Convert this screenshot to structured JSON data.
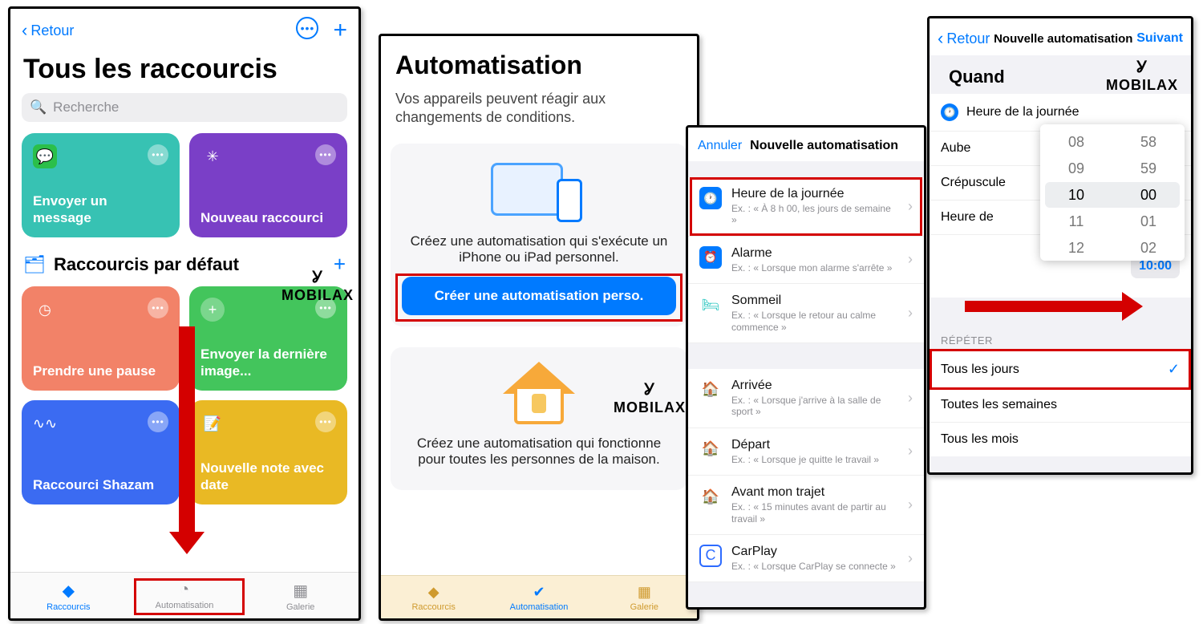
{
  "screen1": {
    "back": "Retour",
    "title": "Tous les raccourcis",
    "search_placeholder": "Recherche",
    "tiles": [
      {
        "label": "Envoyer un message",
        "color": "teal"
      },
      {
        "label": "Nouveau raccourci",
        "color": "purple"
      },
      {
        "label": "Prendre une pause",
        "color": "coral"
      },
      {
        "label": "Envoyer la dernière image...",
        "color": "green"
      },
      {
        "label": "Raccourci Shazam",
        "color": "blue"
      },
      {
        "label": "Nouvelle note avec date",
        "color": "yellow"
      }
    ],
    "folder": "Raccourcis par défaut",
    "tabs": [
      "Raccourcis",
      "Automatisation",
      "Galerie"
    ]
  },
  "screen2": {
    "title": "Automatisation",
    "subtitle": "Vos appareils peuvent réagir aux changements de conditions.",
    "card1_desc": "Créez une automatisation qui s'exécute un iPhone ou iPad personnel.",
    "card1_button": "Créer une automatisation perso.",
    "card2_desc": "Créez une automatisation qui fonctionne pour toutes les personnes de la maison.",
    "tabs": [
      "Raccourcis",
      "Automatisation",
      "Galerie"
    ]
  },
  "screen3": {
    "cancel": "Annuler",
    "title": "Nouvelle automatisation",
    "rows": [
      {
        "name": "Heure de la journée",
        "ex": "Ex. : « À 8 h 00, les jours de semaine »",
        "icon": "clock"
      },
      {
        "name": "Alarme",
        "ex": "Ex. : « Lorsque mon alarme s'arrête »",
        "icon": "alarm"
      },
      {
        "name": "Sommeil",
        "ex": "Ex. : « Lorsque le retour au calme commence »",
        "icon": "bed"
      },
      {
        "name": "Arrivée",
        "ex": "Ex. : « Lorsque j'arrive à la salle de sport »",
        "icon": "home"
      },
      {
        "name": "Départ",
        "ex": "Ex. : « Lorsque je quitte le travail »",
        "icon": "home"
      },
      {
        "name": "Avant mon trajet",
        "ex": "Ex. : « 15 minutes avant de partir au travail »",
        "icon": "home"
      },
      {
        "name": "CarPlay",
        "ex": "Ex. : « Lorsque CarPlay se connecte »",
        "icon": "cp"
      }
    ]
  },
  "screen4": {
    "back": "Retour",
    "title": "Nouvelle automatisation",
    "next": "Suivant",
    "quand": "Quand",
    "row_title": "Heure de la journée",
    "options": [
      "Aube",
      "Crépuscule",
      "Heure de"
    ],
    "time": "10:00",
    "repeat_label": "RÉPÉTER",
    "repeat_opts": [
      "Tous les jours",
      "Toutes les semaines",
      "Tous les mois"
    ],
    "picker": {
      "hours": [
        "08",
        "09",
        "10",
        "11",
        "12"
      ],
      "mins": [
        "58",
        "59",
        "00",
        "01",
        "02"
      ],
      "sel_h": "10",
      "sel_m": "00"
    }
  },
  "brand": "MOBILAX"
}
